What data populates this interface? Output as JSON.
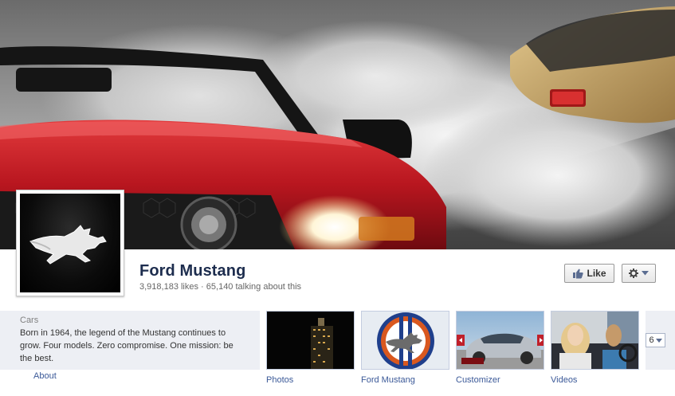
{
  "page": {
    "name": "Ford Mustang",
    "likes": "3,918,183 likes",
    "separator": " · ",
    "talking": "65,140 talking about this"
  },
  "actions": {
    "like_label": "Like",
    "settings_icon": "gear-icon"
  },
  "about": {
    "category": "Cars",
    "description": "Born in 1964, the legend of the Mustang continues to grow. Four models. Zero compromise. One mission: be the best.",
    "link_label": "About"
  },
  "apps": [
    {
      "label": "Photos"
    },
    {
      "label": "Ford Mustang"
    },
    {
      "label": "Customizer"
    },
    {
      "label": "Videos"
    }
  ],
  "more": {
    "count": "6"
  },
  "colors": {
    "link": "#3b5998",
    "title": "#1d2d4e",
    "panel": "#edeff4",
    "car_red": "#b8161f",
    "car_gold": "#c9a86a"
  }
}
